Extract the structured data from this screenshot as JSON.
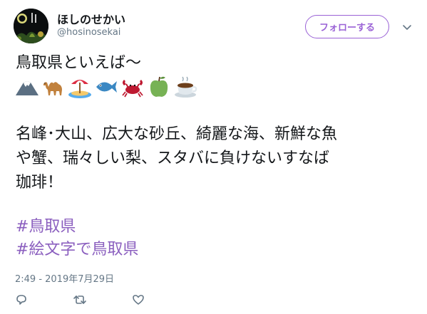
{
  "user": {
    "name": "ほしのせかい",
    "handle": "@hosinosekai"
  },
  "follow_button": {
    "label": "フォローする"
  },
  "menu": {
    "icon": "chevron-down-icon"
  },
  "tweet": {
    "line1": "鳥取県といえば〜",
    "emojis": [
      {
        "name": "mount-fuji-icon"
      },
      {
        "name": "camel-icon"
      },
      {
        "name": "beach-umbrella-icon"
      },
      {
        "name": "fish-icon"
      },
      {
        "name": "crab-icon"
      },
      {
        "name": "green-apple-icon"
      },
      {
        "name": "coffee-icon"
      }
    ],
    "paragraph_lines": [
      "名峰･大山、広大な砂丘、綺麗な海、新鮮な魚",
      "や蟹、瑞々しい梨、スタバに負けないすなば",
      "珈琲！"
    ],
    "hashtags": [
      "#鳥取県",
      "#絵文字で鳥取県"
    ]
  },
  "timestamp": "2:49 - 2019年7月29日",
  "actions": [
    {
      "name": "reply-icon"
    },
    {
      "name": "retweet-icon"
    },
    {
      "name": "like-icon"
    }
  ],
  "colors": {
    "accent": "#8b5fbf",
    "button_border": "#9a62d6",
    "muted_text": "#657786",
    "text": "#14171a"
  }
}
